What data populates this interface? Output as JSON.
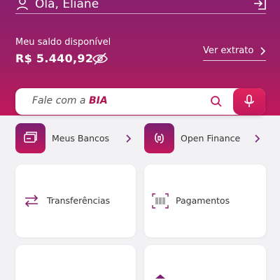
{
  "header": {
    "greeting": "Olá, Eliane",
    "balance_label": "Meu saldo disponível",
    "balance_value": "R$ 5.440,92",
    "statement_link": "Ver extrato"
  },
  "search": {
    "prefix": "Fale com a ",
    "assistant_name": "BIA"
  },
  "shortcuts": [
    {
      "label": "Meus Bancos",
      "icon": "bank-icon"
    },
    {
      "label": "Open Finance",
      "icon": "open-finance-icon"
    }
  ],
  "cards": [
    {
      "label": "Transferências",
      "icon": "transfer-icon"
    },
    {
      "label": "Pagamentos",
      "icon": "barcode-icon"
    }
  ],
  "colors": {
    "brand_dark": "#8a1f6e",
    "brand_accent": "#c2185b",
    "background": "#f2f2f4"
  }
}
